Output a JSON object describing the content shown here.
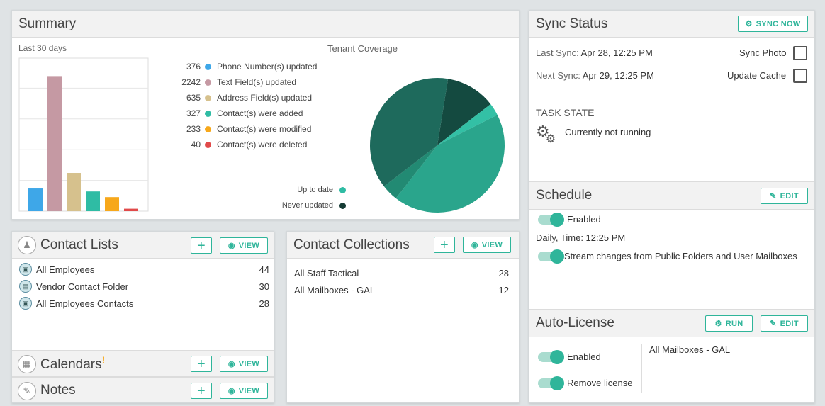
{
  "summary": {
    "title": "Summary",
    "period": "Last 30 days",
    "coverage_title": "Tenant Coverage",
    "legend": [
      {
        "value": "376",
        "label": "Phone Number(s) updated",
        "color": "#3ea7e8"
      },
      {
        "value": "2242",
        "label": "Text Field(s) updated",
        "color": "#c599a3"
      },
      {
        "value": "635",
        "label": "Address Field(s) updated",
        "color": "#d6c18d"
      },
      {
        "value": "327",
        "label": "Contact(s) were added",
        "color": "#2fbca4"
      },
      {
        "value": "233",
        "label": "Contact(s) were modified",
        "color": "#f7a81b"
      },
      {
        "value": "40",
        "label": "Contact(s) were deleted",
        "color": "#e14a4a"
      }
    ],
    "pie_legend": [
      {
        "label": "Up to date",
        "color": "#2fbca4"
      },
      {
        "label": "Never updated",
        "color": "#153b34"
      }
    ]
  },
  "chart_data": [
    {
      "type": "bar",
      "categories": [
        "Phone Number(s) updated",
        "Text Field(s) updated",
        "Address Field(s) updated",
        "Contact(s) were added",
        "Contact(s) were modified",
        "Contact(s) were deleted"
      ],
      "values": [
        376,
        2242,
        635,
        327,
        233,
        40
      ],
      "colors": [
        "#3ea7e8",
        "#c599a3",
        "#d6c18d",
        "#2fbca4",
        "#f7a81b",
        "#e14a4a"
      ],
      "ylim": [
        0,
        2500
      ],
      "grid": true
    },
    {
      "type": "pie",
      "title": "Tenant Coverage",
      "slices": [
        {
          "value": 12,
          "color": "#144a40"
        },
        {
          "value": 3,
          "color": "#33c0a5"
        },
        {
          "value": 43,
          "color": "#2aa58c"
        },
        {
          "value": 4,
          "color": "#228a73"
        },
        {
          "value": 38,
          "color": "#1e6a5c"
        }
      ]
    }
  ],
  "contact_lists": {
    "title": "Contact Lists",
    "plus_label": "+",
    "view_label": "VIEW",
    "items": [
      {
        "name": "All Employees",
        "count": "44"
      },
      {
        "name": "Vendor Contact Folder",
        "count": "30"
      },
      {
        "name": "All Employees Contacts",
        "count": "28"
      }
    ]
  },
  "calendars": {
    "title": "Calendars",
    "alert": "!",
    "plus_label": "+",
    "view_label": "VIEW"
  },
  "notes": {
    "title": "Notes",
    "plus_label": "+",
    "view_label": "VIEW"
  },
  "contact_collections": {
    "title": "Contact Collections",
    "plus_label": "+",
    "view_label": "VIEW",
    "items": [
      {
        "name": "All Staff Tactical",
        "count": "28"
      },
      {
        "name": "All Mailboxes - GAL",
        "count": "12"
      }
    ]
  },
  "sync_status": {
    "title": "Sync Status",
    "sync_now_label": "SYNC NOW",
    "last_sync_label": "Last Sync:",
    "last_sync_value": "Apr 28, 12:25 PM",
    "next_sync_label": "Next Sync:",
    "next_sync_value": "Apr 29, 12:25 PM",
    "sync_photo_label": "Sync Photo",
    "update_cache_label": "Update Cache",
    "task_state_label": "TASK STATE",
    "task_state_value": "Currently not running"
  },
  "schedule": {
    "title": "Schedule",
    "edit_label": "EDIT",
    "enabled_label": "Enabled",
    "time_text": "Daily, Time: 12:25 PM",
    "stream_label": "Stream changes from Public Folders and User Mailboxes"
  },
  "auto_license": {
    "title": "Auto-License",
    "run_label": "RUN",
    "edit_label": "EDIT",
    "enabled_label": "Enabled",
    "remove_label": "Remove license",
    "target": "All Mailboxes - GAL"
  }
}
